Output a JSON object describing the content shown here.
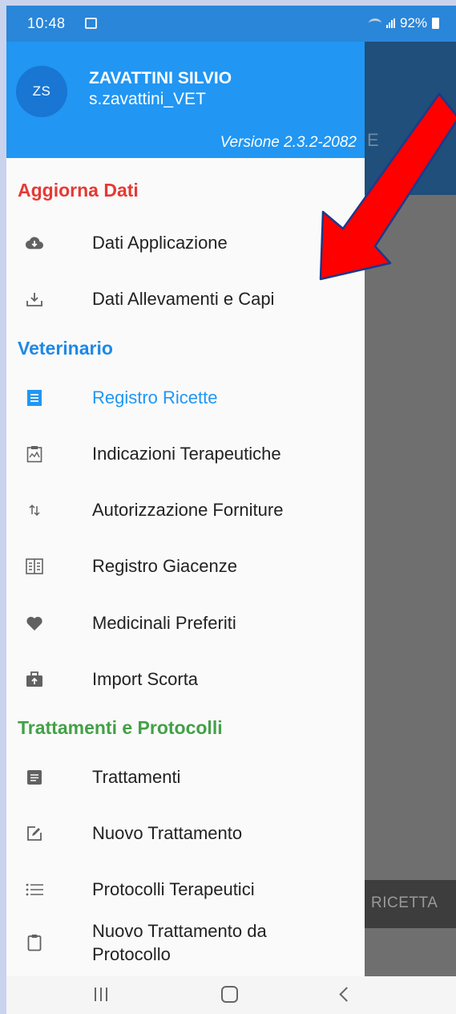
{
  "status_bar": {
    "time": "10:48",
    "battery": "92%"
  },
  "background_app": {
    "tab_fragment": "E",
    "bottom_action": "RICETTA"
  },
  "drawer": {
    "header": {
      "initials": "ZS",
      "name": "ZAVATTINI SILVIO",
      "username": "s.zavattini_VET",
      "version": "Versione 2.3.2-2082"
    },
    "sections": {
      "aggiorna": "Aggiorna Dati",
      "veterinario": "Veterinario",
      "trattamenti": "Trattamenti e Protocolli"
    },
    "items": {
      "dati_applicazione": "Dati Applicazione",
      "dati_allevamenti": "Dati Allevamenti e Capi",
      "registro_ricette": "Registro Ricette",
      "indicazioni": "Indicazioni Terapeutiche",
      "autorizzazione": "Autorizzazione Forniture",
      "giacenze": "Registro Giacenze",
      "preferiti": "Medicinali Preferiti",
      "import_scorta": "Import Scorta",
      "trattamenti": "Trattamenti",
      "nuovo_trattamento": "Nuovo Trattamento",
      "protocolli": "Protocolli Terapeutici",
      "nuovo_da_protocollo_l1": "Nuovo Trattamento da",
      "nuovo_da_protocollo_l2": "Protocollo"
    }
  },
  "colors": {
    "header_blue": "#2196f3",
    "section_red": "#e53935",
    "section_blue": "#1e88e5",
    "section_green": "#43a047",
    "active_blue": "#2196f3",
    "arrow_red": "#ff0000",
    "arrow_outline": "#1a3a8c"
  }
}
